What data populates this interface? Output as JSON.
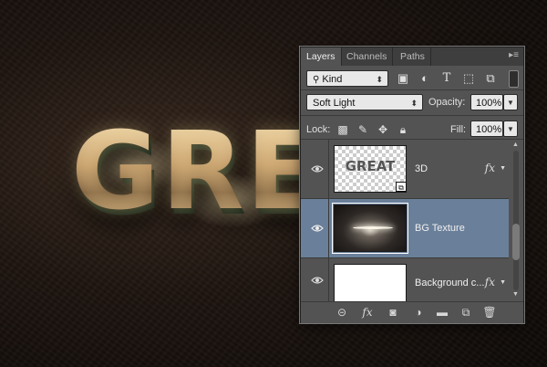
{
  "artwork": {
    "text": "GRE"
  },
  "panel": {
    "tabs": [
      {
        "label": "Layers"
      },
      {
        "label": "Channels"
      },
      {
        "label": "Paths"
      }
    ],
    "filter": {
      "kind_label": "Kind",
      "filter_icons": [
        "image-filter-icon",
        "adjustment-filter-icon",
        "type-filter-icon",
        "shape-filter-icon",
        "smart-object-filter-icon"
      ]
    },
    "blend": {
      "mode": "Soft Light",
      "opacity_label": "Opacity:",
      "opacity_value": "100%"
    },
    "lock": {
      "label": "Lock:",
      "fill_label": "Fill:",
      "fill_value": "100%"
    },
    "layers": [
      {
        "name": "3D",
        "thumb_text": "GREAT",
        "has_fx": true,
        "selected": false
      },
      {
        "name": "BG Texture",
        "has_fx": false,
        "selected": true
      },
      {
        "name": "Background c...",
        "has_fx": true,
        "selected": false
      }
    ]
  }
}
